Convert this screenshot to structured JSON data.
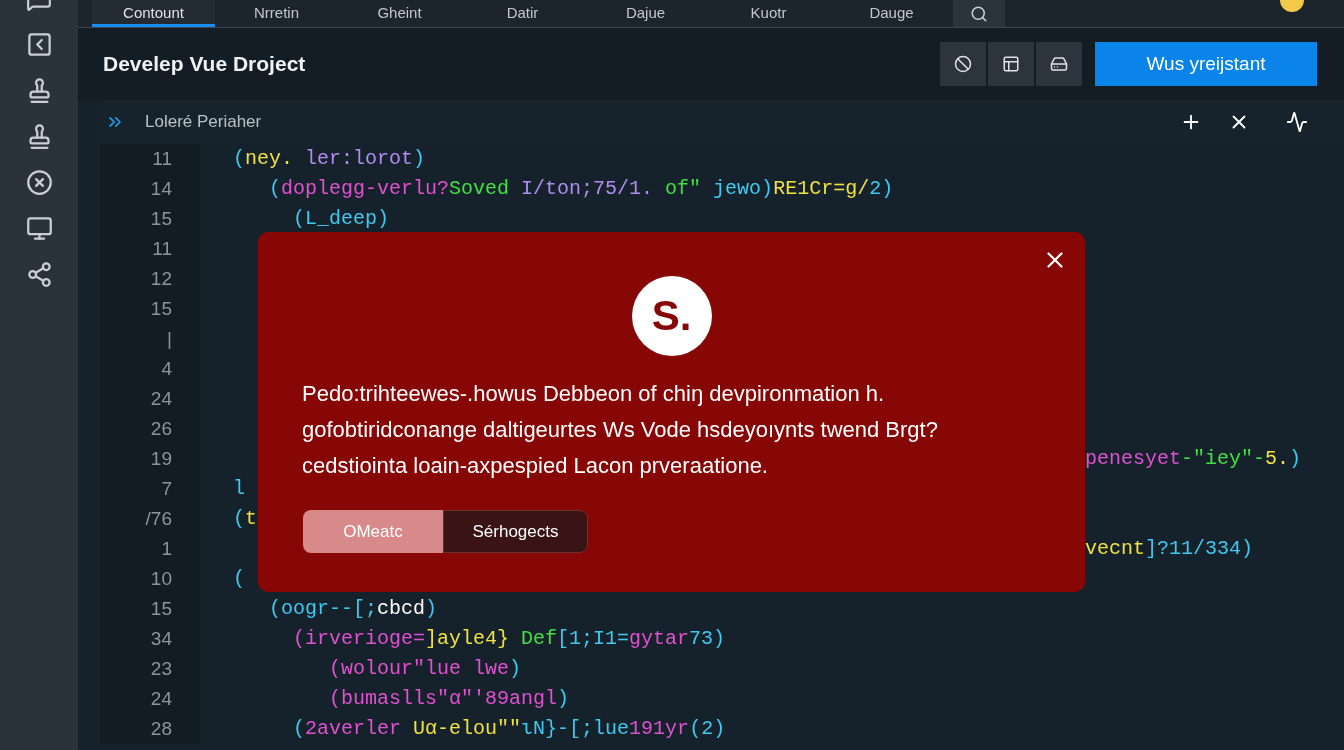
{
  "tabs": [
    {
      "label": "Contount",
      "selected": true
    },
    {
      "label": "Nrretin",
      "selected": false
    },
    {
      "label": "Gheint",
      "selected": false
    },
    {
      "label": "Datir",
      "selected": false
    },
    {
      "label": "Dajue",
      "selected": false
    },
    {
      "label": "Kuotr",
      "selected": false
    },
    {
      "label": "Dauge",
      "selected": false
    }
  ],
  "header": {
    "title": "Develep Vue Droject",
    "primary_button": "Wus yreijstant"
  },
  "panel": {
    "title": "Loleré Periaher"
  },
  "code_lines": [
    {
      "number": "11",
      "code": [
        {
          "text": "(",
          "color": "#3fc8f0"
        },
        {
          "text": "ney.",
          "color": "#f0e040"
        },
        {
          "text": " ler:lorot",
          "color": "#b08cf0"
        },
        {
          "text": ")",
          "color": "#3fc8f0"
        }
      ]
    },
    {
      "number": "14",
      "code": [
        {
          "text": "   (",
          "color": "#3fc8f0"
        },
        {
          "text": "doplegg-verlu?",
          "color": "#e050d0"
        },
        {
          "text": "Soved",
          "color": "#40e040"
        },
        {
          "text": " I/ton;75/1.",
          "color": "#b08cf0"
        },
        {
          "text": " of\"",
          "color": "#40e040"
        },
        {
          "text": " jewo)",
          "color": "#3fc8f0"
        },
        {
          "text": "RE1Cr=g/",
          "color": "#f0e040"
        },
        {
          "text": "2)",
          "color": "#3fc8f0"
        }
      ]
    },
    {
      "number": "15",
      "code": [
        {
          "text": "     (L_deep)",
          "color": "#3fc8f0"
        }
      ]
    },
    {
      "number": "11"
    },
    {
      "number": "12"
    },
    {
      "number": "15"
    },
    {
      "number": "|"
    },
    {
      "number": "4"
    },
    {
      "number": "24"
    },
    {
      "number": "26"
    },
    {
      "number": "19",
      "tail": [
        {
          "text": "penesyet",
          "color": "#e050d0"
        },
        {
          "text": "-\"iey\"-",
          "color": "#40e040"
        },
        {
          "text": "5.",
          "color": "#f0e040"
        },
        {
          "text": ")",
          "color": "#3fc8f0"
        }
      ]
    },
    {
      "number": "7",
      "code": [
        {
          "text": "l",
          "color": "#3fc8f0"
        }
      ]
    },
    {
      "number": "/76",
      "code": [
        {
          "text": "(",
          "color": "#3fc8f0"
        },
        {
          "text": "t",
          "color": "#f0e040"
        }
      ]
    },
    {
      "number": "1",
      "tail": [
        {
          "text": "vecnt",
          "color": "#f0e040"
        },
        {
          "text": "]?11/334)",
          "color": "#3fc8f0"
        }
      ]
    },
    {
      "number": "10",
      "code": [
        {
          "text": "(",
          "color": "#3fc8f0"
        }
      ]
    },
    {
      "number": "15",
      "code": [
        {
          "text": "   (oogr--[;",
          "color": "#3fc8f0"
        },
        {
          "text": "cbcd",
          "color": "#ffffff"
        },
        {
          "text": ")",
          "color": "#3fc8f0"
        }
      ]
    },
    {
      "number": "34",
      "code": [
        {
          "text": "     (irverioge=",
          "color": "#e050d0"
        },
        {
          "text": "]ayle4}",
          "color": "#f0e040"
        },
        {
          "text": " Def",
          "color": "#40e040"
        },
        {
          "text": "[1;I1=",
          "color": "#3fc8f0"
        },
        {
          "text": "gytar",
          "color": "#e050d0"
        },
        {
          "text": "73)",
          "color": "#3fc8f0"
        }
      ]
    },
    {
      "number": "23",
      "code": [
        {
          "text": "        (wolour\"lue lwe",
          "color": "#e050d0"
        },
        {
          "text": ")",
          "color": "#3fc8f0"
        }
      ]
    },
    {
      "number": "24",
      "code": [
        {
          "text": "        (bumaslls\"α\"'89angl",
          "color": "#e050d0"
        },
        {
          "text": ")",
          "color": "#3fc8f0"
        }
      ]
    },
    {
      "number": "28",
      "code": [
        {
          "text": "     (",
          "color": "#3fc8f0"
        },
        {
          "text": "2averler ",
          "color": "#e050d0"
        },
        {
          "text": "Uα-elou\"\"",
          "color": "#f0e040"
        },
        {
          "text": "ιN}-[;lue",
          "color": "#3fc8f0"
        },
        {
          "text": "191yr",
          "color": "#e050d0"
        },
        {
          "text": "(2)",
          "color": "#3fc8f0"
        }
      ]
    }
  ],
  "dialog": {
    "logo_text": "S.",
    "message_lines": [
      "Pedo:trihteewes-.howus Debbeon of chiŋ devpironmation h.",
      "gofobtiridconange daltigeurtes Ws Vode hsdeyoıynts twend Brgt?",
      "cedstiointa loain-axpespied Lacon prveraatione."
    ],
    "buttons": [
      {
        "label": "OMeatc",
        "selected": true
      },
      {
        "label": "Sérhogects",
        "selected": false
      }
    ]
  }
}
